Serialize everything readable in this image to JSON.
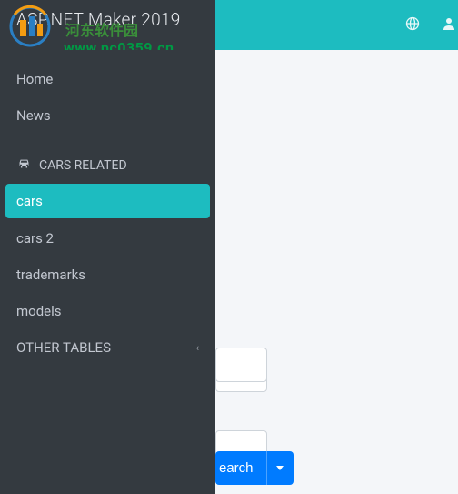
{
  "brand": {
    "title": "ASP.NET Maker 2019",
    "watermark_top": "河东软件园",
    "watermark_url": "www.pc0359.cn"
  },
  "topbar": {
    "globe_icon": "globe",
    "user_icon": "user"
  },
  "sidebar": {
    "items": [
      {
        "label": "Home",
        "active": false
      },
      {
        "label": "News",
        "active": false
      }
    ],
    "section_header": "CARS RELATED",
    "cars_items": [
      {
        "label": "cars",
        "active": true
      },
      {
        "label": "cars 2",
        "active": false
      },
      {
        "label": "trademarks",
        "active": false
      },
      {
        "label": "models",
        "active": false
      }
    ],
    "other_tables": "OTHER TABLES"
  },
  "main": {
    "inputs": [
      {
        "value": ""
      },
      {
        "value": ""
      },
      {
        "value": ""
      }
    ],
    "search_label": "earch"
  },
  "colors": {
    "accent": "#1dbcc0",
    "sidebar_bg": "#343a40",
    "primary_btn": "#007bff"
  }
}
